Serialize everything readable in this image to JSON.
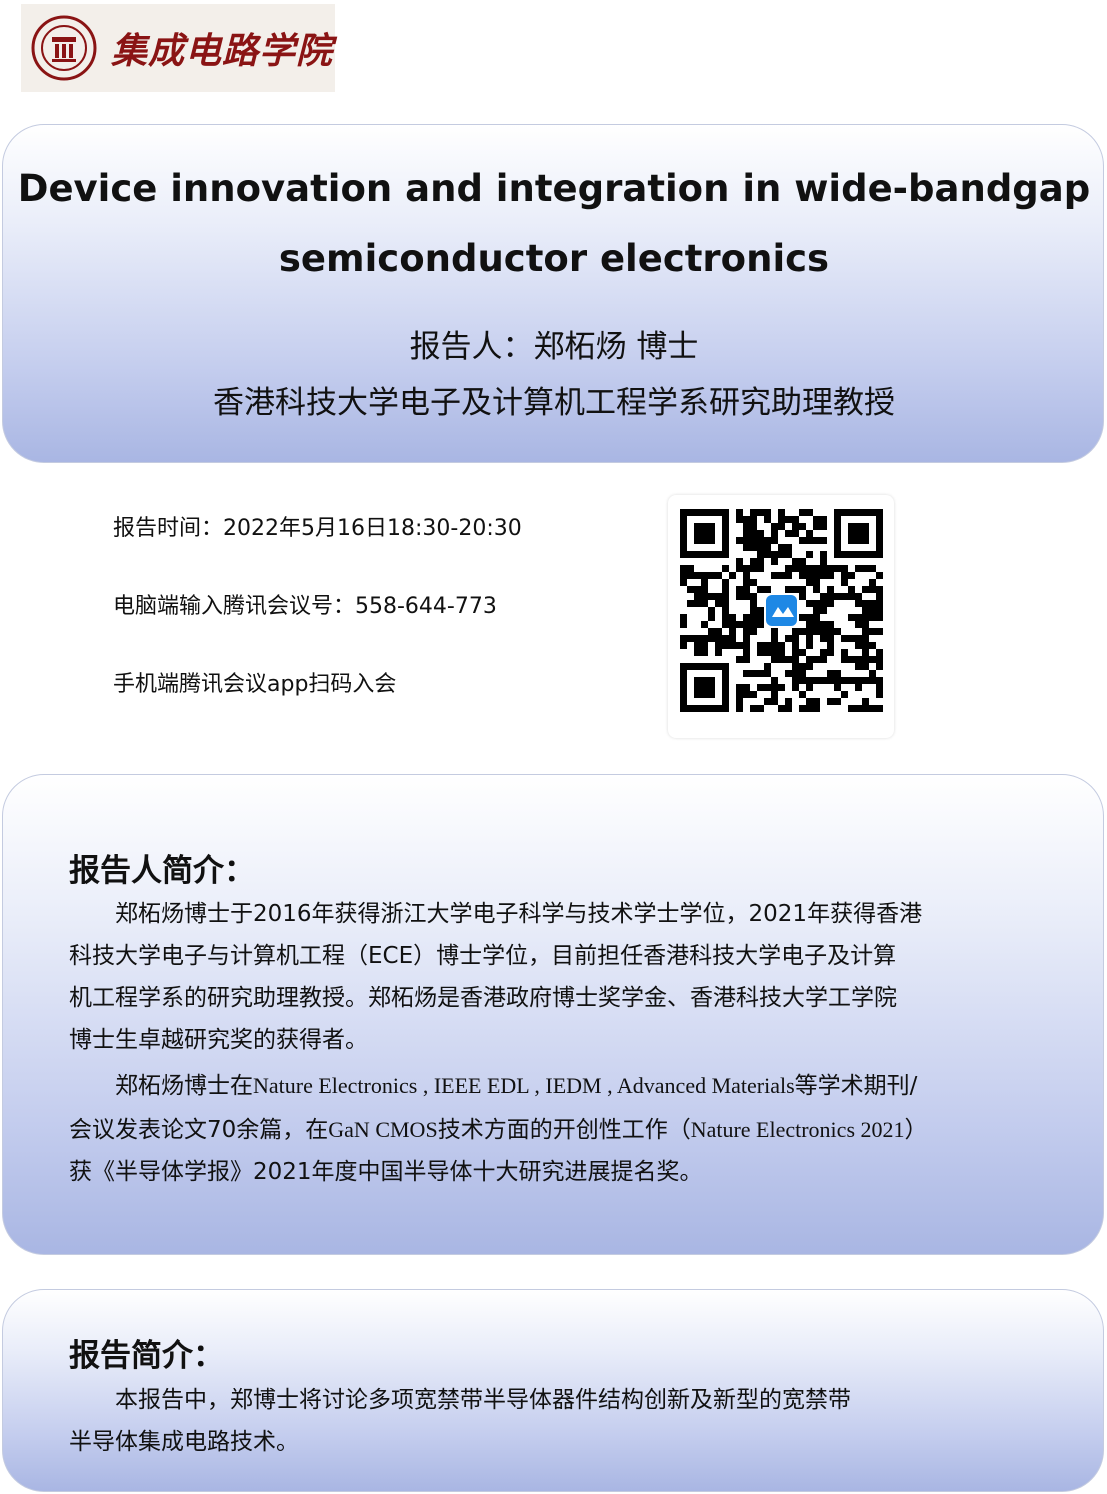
{
  "logo": {
    "text": "集成电路学院"
  },
  "header": {
    "title_line1": "Device innovation and integration in wide-bandgap",
    "title_line2": "semiconductor electronics",
    "speaker_line": "报告人：郑柘炀  博士",
    "affiliation": "香港科技大学电子及计算机工程学系研究助理教授"
  },
  "meeting": {
    "time_text": "报告时间：2022年5月16日18:30-20:30",
    "meeting_id_text": "电脑端输入腾讯会议号：558-644-773",
    "mobile_text": "手机端腾讯会议app扫码入会"
  },
  "bio": {
    "heading": "报告人简介：",
    "p1_l1": "郑柘炀博士于2016年获得浙江大学电子科学与技术学士学位，2021年获得香港",
    "p1_l2": "科技大学电子与计算机工程（ECE）博士学位，目前担任香港科技大学电子及计算",
    "p1_l3": "机工程学系的研究助理教授。郑柘炀是香港政府博士奖学金、香港科技大学工学院",
    "p1_l4": "博士生卓越研究奖的获得者。",
    "p2_l1_a": "郑柘炀博士在",
    "p2_l1_b": "Nature  Electronics , IEEE   EDL , IEDM , Advanced  Materials",
    "p2_l1_c": "等学术期刊/",
    "p2_l2_a": "会议发表论文70余篇，在",
    "p2_l2_b": "GaN  CMOS",
    "p2_l2_c": "技术方面的开创性工作（",
    "p2_l2_d": "Nature  Electronics  2021",
    "p2_l2_e": "）",
    "p2_l3": "获《半导体学报》2021年度中国半导体十大研究进展提名奖。"
  },
  "abstract": {
    "heading": "报告简介：",
    "l1": "本报告中，郑博士将讨论多项宽禁带半导体器件结构创新及新型的宽禁带",
    "l2": "半导体集成电路技术。"
  },
  "colors": {
    "panel_gradient_top": "#ffffff",
    "panel_gradient_bottom": "#a9b6e3",
    "logo_red": "#8a1414",
    "qr_center_blue": "#1e88e5"
  }
}
